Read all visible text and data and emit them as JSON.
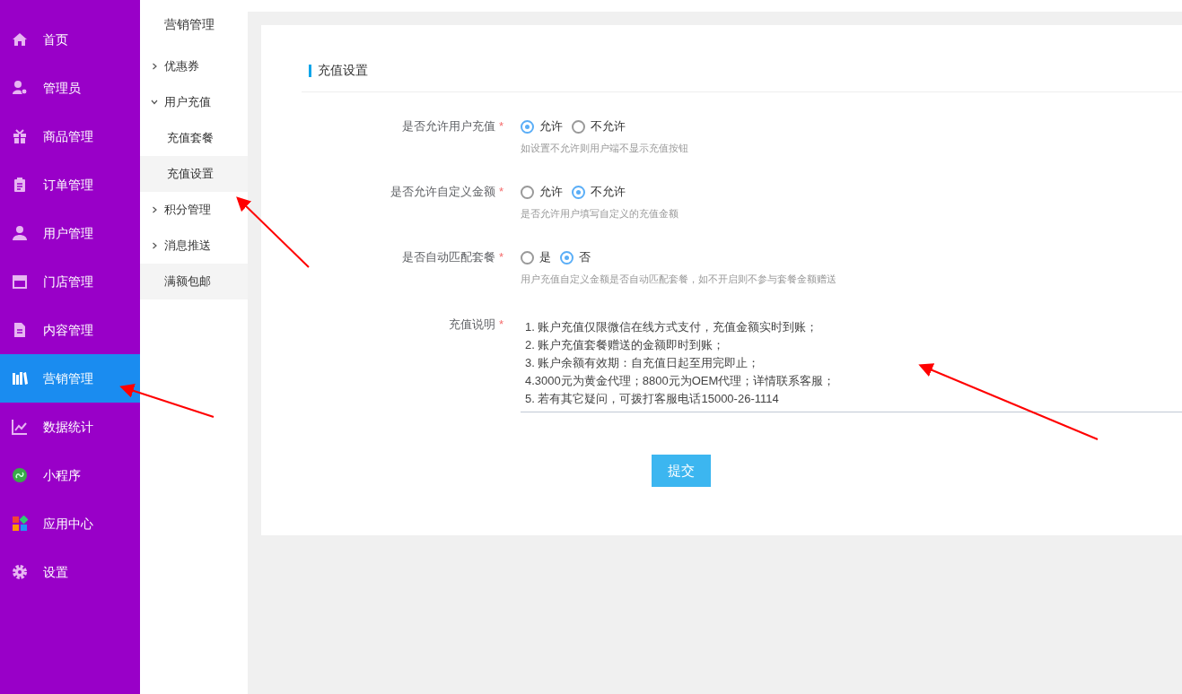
{
  "sidebar": {
    "items": [
      {
        "label": "首页",
        "selected": false
      },
      {
        "label": "管理员",
        "selected": false
      },
      {
        "label": "商品管理",
        "selected": false
      },
      {
        "label": "订单管理",
        "selected": false
      },
      {
        "label": "用户管理",
        "selected": false
      },
      {
        "label": "门店管理",
        "selected": false
      },
      {
        "label": "内容管理",
        "selected": false
      },
      {
        "label": "营销管理",
        "selected": true
      },
      {
        "label": "数据统计",
        "selected": false
      },
      {
        "label": "小程序",
        "selected": false
      },
      {
        "label": "应用中心",
        "selected": false
      },
      {
        "label": "设置",
        "selected": false
      }
    ]
  },
  "submenu": {
    "title": "营销管理",
    "items": [
      {
        "label": "优惠券",
        "kind": "group",
        "expanded": false
      },
      {
        "label": "用户充值",
        "kind": "group",
        "expanded": true,
        "children": [
          {
            "label": "充值套餐",
            "selected": false
          },
          {
            "label": "充值设置",
            "selected": true
          }
        ]
      },
      {
        "label": "积分管理",
        "kind": "group",
        "expanded": false
      },
      {
        "label": "消息推送",
        "kind": "group",
        "expanded": false
      },
      {
        "label": "满额包邮",
        "kind": "link",
        "hovered": true
      }
    ]
  },
  "section_title": "充值设置",
  "form": {
    "fields": [
      {
        "kind": "radio",
        "label": "是否允许用户充值",
        "required_mark": "*",
        "options": [
          {
            "label": "允许",
            "selected": true
          },
          {
            "label": "不允许",
            "selected": false
          }
        ],
        "hint": "如设置不允许则用户端不显示充值按钮"
      },
      {
        "kind": "radio",
        "label": "是否允许自定义金额",
        "required_mark": "*",
        "options": [
          {
            "label": "允许",
            "selected": false
          },
          {
            "label": "不允许",
            "selected": true
          }
        ],
        "hint": "是否允许用户填写自定义的充值金额"
      },
      {
        "kind": "radio",
        "label": "是否自动匹配套餐",
        "required_mark": "*",
        "options": [
          {
            "label": "是",
            "selected": false
          },
          {
            "label": "否",
            "selected": true
          }
        ],
        "hint": "用户充值自定义金额是否自动匹配套餐，如不开启则不参与套餐金额赠送"
      },
      {
        "kind": "textarea",
        "label": "充值说明",
        "required_mark": "*",
        "value": "1. 账户充值仅限微信在线方式支付，充值金额实时到账；\n2. 账户充值套餐赠送的金额即时到账；\n3. 账户余额有效期：自充值日起至用完即止；\n4.3000元为黄金代理；8800元为OEM代理；详情联系客服；\n5. 若有其它疑问，可拨打客服电话15000-26-1114"
      }
    ],
    "submit": "提交"
  }
}
